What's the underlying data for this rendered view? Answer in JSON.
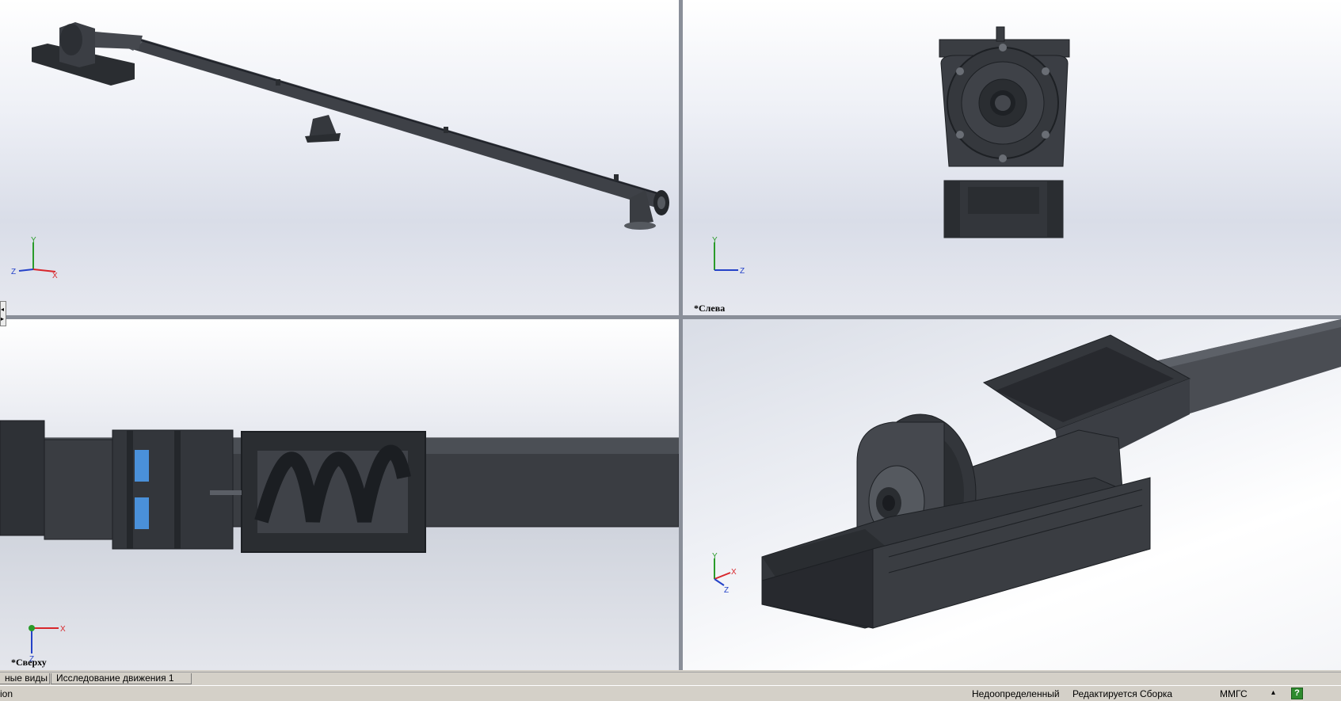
{
  "viewports": {
    "left_view_label": "*Слева",
    "top_view_label": "*Сверху"
  },
  "axes": {
    "x": "X",
    "y": "Y",
    "z": "Z"
  },
  "tabs": [
    "ные виды",
    "Исследование движения 1"
  ],
  "status": {
    "left_text": "ion",
    "definition": "Недоопределенный",
    "mode": "Редактируется Сборка",
    "units": "ММГС",
    "units_caret": "▴",
    "help": "?"
  },
  "colors": {
    "part": "#3a3d42",
    "part_dark": "#24272b",
    "part_light": "#5b5f66",
    "flighting_blue": "#4a90d9",
    "axis_x": "#d8262b",
    "axis_y": "#2a9b2a",
    "axis_z": "#2442c8"
  }
}
